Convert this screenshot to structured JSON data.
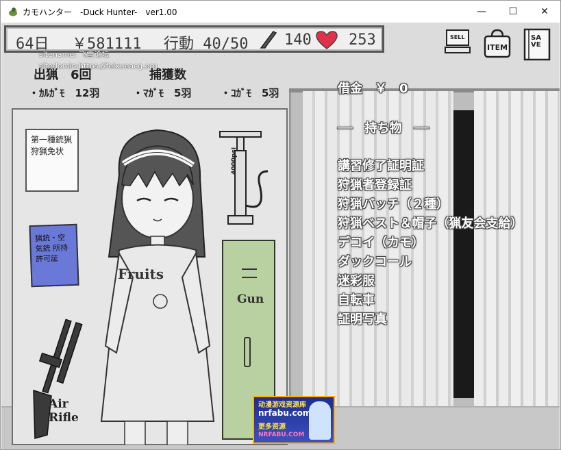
{
  "window": {
    "title": "カモハンター　-Duck Hunter-　ver1.00",
    "minimize": "—",
    "maximize": "☐",
    "close": "✕"
  },
  "status": {
    "day": "64日",
    "money": "￥581111",
    "action": "行動 40/50",
    "ammo": "140",
    "hp": "253"
  },
  "watermark": {
    "line1": "sitename: 飞雪论坛",
    "line2": "sitedomin:https://feixueacg.org"
  },
  "hud_buttons": {
    "sell": "SELL",
    "item": "ITEM",
    "save": "SAVE"
  },
  "hunt": {
    "outings": "出猟　6回",
    "catch_header": "捕獲数",
    "karugamo": "・ｶﾙｶﾞﾓ　12羽",
    "magamo": "・ﾏｶﾞﾓ　5羽",
    "kogamo": "・ｺｶﾞﾓ　5羽"
  },
  "debt": "借金　￥　0",
  "inventory": {
    "header": "──　持ち物　──",
    "items": [
      "講習修了証明証",
      "狩猟者登録証",
      "狩猟バッチ（２種）",
      "狩猟ベスト＆帽子（猟友会支給）",
      "デコイ（カモ）",
      "ダックコール",
      "迷彩服",
      "自転車",
      "証明写真"
    ]
  },
  "scene": {
    "poster": "第一種銃猟 狩猟免状",
    "book": "猟銃・空気銃 所持許可証",
    "shirt": "Fruits",
    "locker": "Gun",
    "rifle_label": "Air Rifle",
    "pump_label": "4000psi"
  },
  "ad_banner": {
    "line1": "动漫游戏资源库",
    "line2": "nrfabu.com",
    "line3": "更多资源",
    "line4": "NRFABU.COM"
  },
  "colors": {
    "heart": "#e0304a",
    "locker": "#b9d1a0",
    "book": "#6a78d8"
  }
}
